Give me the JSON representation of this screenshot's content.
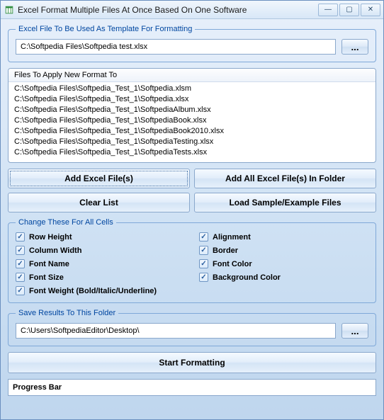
{
  "titlebar": {
    "title": "Excel Format Multiple Files At Once Based On One Software"
  },
  "template_section": {
    "legend": "Excel File To Be Used As Template For Formatting",
    "path": "C:\\Softpedia Files\\Softpedia test.xlsx",
    "browse": "..."
  },
  "files_list": {
    "header": "Files To Apply New Format To",
    "items": [
      "C:\\Softpedia Files\\Softpedia_Test_1\\Softpedia.xlsm",
      "C:\\Softpedia Files\\Softpedia_Test_1\\Softpedia.xlsx",
      "C:\\Softpedia Files\\Softpedia_Test_1\\SoftpediaAlbum.xlsx",
      "C:\\Softpedia Files\\Softpedia_Test_1\\SoftpediaBook.xlsx",
      "C:\\Softpedia Files\\Softpedia_Test_1\\SoftpediaBook2010.xlsx",
      "C:\\Softpedia Files\\Softpedia_Test_1\\SoftpediaTesting.xlsx",
      "C:\\Softpedia Files\\Softpedia_Test_1\\SoftpediaTests.xlsx"
    ]
  },
  "buttons": {
    "add_files": "Add Excel File(s)",
    "add_folder": "Add All Excel File(s) In Folder",
    "clear": "Clear List",
    "load_sample": "Load Sample/Example Files"
  },
  "change_section": {
    "legend": "Change These For All Cells",
    "checks": {
      "row_height": "Row Height",
      "alignment": "Alignment",
      "column_width": "Column Width",
      "border": "Border",
      "font_name": "Font Name",
      "font_color": "Font Color",
      "font_size": "Font Size",
      "background_color": "Background Color",
      "font_weight": "Font Weight (Bold/Italic/Underline)"
    }
  },
  "save_section": {
    "legend": "Save Results To This Folder",
    "path": "C:\\Users\\SoftpediaEditor\\Desktop\\",
    "browse": "..."
  },
  "start_button": "Start Formatting",
  "progress_label": "Progress Bar"
}
